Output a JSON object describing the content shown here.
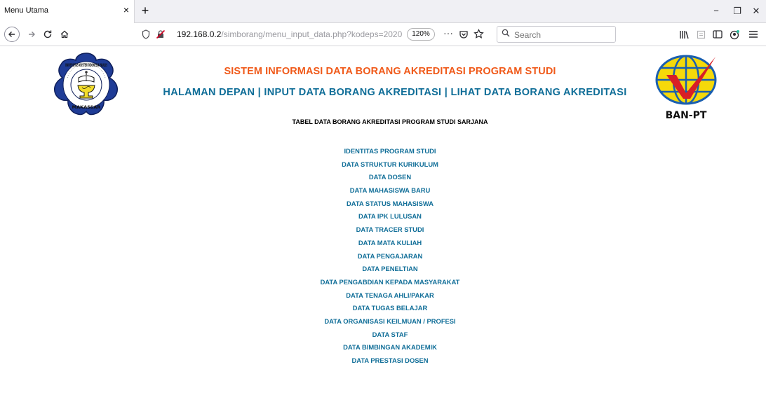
{
  "browser": {
    "tab_title": "Menu Utama",
    "tab_close": "×",
    "new_tab": "+",
    "window_buttons": {
      "minimize": "−",
      "restore": "❐",
      "close": "✕"
    },
    "url_host": "192.168.0.2",
    "url_path": "/simborang/menu_input_data.php?kodeps=2020",
    "zoom": "120%",
    "page_actions": "···",
    "search_placeholder": "Search",
    "icons": [
      "back-icon",
      "forward-icon",
      "reload-icon",
      "home-icon",
      "shield-icon",
      "insecure-lock-icon",
      "pocket-icon",
      "bookmark-star-icon",
      "search-icon",
      "library-icon",
      "reader-icon",
      "sidebar-icon",
      "account-icon",
      "menu-icon"
    ]
  },
  "header": {
    "title": "SISTEM INFORMASI DATA BORANG AKREDITASI PROGRAM STUDI",
    "nav": [
      {
        "label": "HALAMAN DEPAN"
      },
      {
        "label": "INPUT DATA BORANG AKREDITASI"
      },
      {
        "label": "LIHAT DATA BORANG AKREDITASI"
      }
    ],
    "separator": "|",
    "logo_left": {
      "top_text": "UNIVERSITAS KRISTEN INDONESIA PAULUS",
      "bottom_text": "MAKASSAR"
    },
    "logo_right": {
      "text": "BAN-PT"
    }
  },
  "main": {
    "table_title": "TABEL DATA BORANG AKREDITASI PROGRAM STUDI SARJANA",
    "menu": [
      "IDENTITAS PROGRAM STUDI",
      "DATA STRUKTUR KURIKULUM",
      "DATA DOSEN",
      "DATA MAHASISWA BARU",
      "DATA STATUS MAHASISWA",
      "DATA IPK LULUSAN",
      "DATA TRACER STUDI",
      "DATA MATA KULIAH",
      "DATA PENGAJARAN",
      "DATA PENELTIAN",
      "DATA PENGABDIAN KEPADA MASYARAKAT",
      "DATA TENAGA AHLI/PAKAR",
      "DATA TUGAS BELAJAR",
      "DATA ORGANISASI KEILMUAN / PROFESI",
      "DATA STAF",
      "DATA BIMBINGAN AKADEMIK",
      "DATA PRESTASI DOSEN"
    ]
  },
  "colors": {
    "title_orange": "#f05a1a",
    "link_blue": "#106e98",
    "ukip_blue": "#1f3c96",
    "banpt_yellow": "#f5d90a",
    "banpt_red": "#d81f26"
  }
}
